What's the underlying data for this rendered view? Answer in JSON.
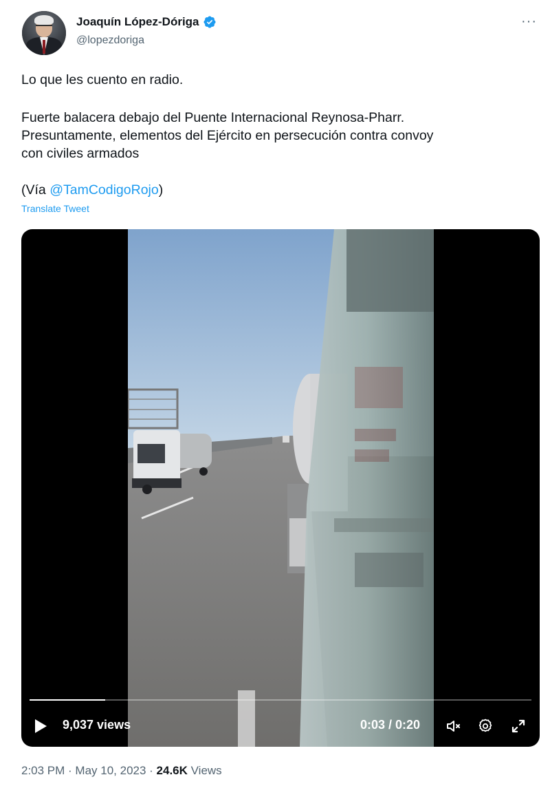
{
  "author": {
    "name": "Joaquín López-Dóriga",
    "handle": "@lopezdoriga",
    "verified_icon": "verified-badge-icon",
    "avatar": "author-avatar"
  },
  "menu": {
    "more_label": "···"
  },
  "tweet": {
    "line1": "Lo que les cuento en radio.",
    "line2": "Fuerte balacera debajo del Puente Internacional Reynosa-Pharr.",
    "line3": "Presuntamente, elementos del Ejército en persecución contra convoy",
    "line4": "con civiles armados",
    "via_prefix": "(Vía ",
    "via_mention": "@TamCodigoRojo",
    "via_suffix": ")",
    "translate_label": "Translate Tweet"
  },
  "video": {
    "views_label": "9,037 views",
    "time_label": "0:03 / 0:20",
    "progress": 0.15,
    "icons": [
      "play-icon",
      "mute-icon",
      "settings-icon",
      "fullscreen-icon"
    ]
  },
  "meta": {
    "time": "2:03 PM",
    "sep1": " · ",
    "date": "May 10, 2023",
    "sep2": " · ",
    "views_count": "24.6K",
    "views_word": " Views"
  },
  "colors": {
    "accent": "#1d9bf0",
    "text": "#0f1419",
    "secondary": "#536471"
  }
}
